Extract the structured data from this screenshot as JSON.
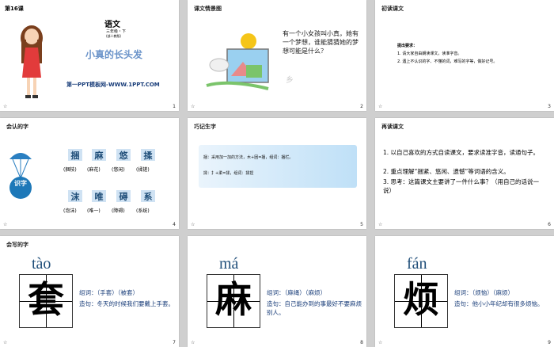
{
  "slides": [
    {
      "num": "1",
      "lesson": "第16课",
      "subject": "语文",
      "grade": "三年级・下",
      "edition": "(部人教版)",
      "title": "小真的长头发",
      "site": "第一PPT模板网-WWW.1PPT.COM"
    },
    {
      "num": "2",
      "header": "课文情景图",
      "text": "有一个小女孩叫小真，她有一个梦想，谁能猜猜她的梦想可能是什么？"
    },
    {
      "num": "3",
      "header": "初读课文",
      "req_title": "提出要求：",
      "req_items": [
        "1. 请大家自由朗读课文，读准字音。",
        "2. 遇上不认识的字、不懂的词，难写的字等，做好记号。"
      ]
    },
    {
      "num": "4",
      "header": "会认的字",
      "badge": "识字",
      "row1": [
        {
          "char": "捆",
          "word": "(捆枝)"
        },
        {
          "char": "麻",
          "word": "(麻花)"
        },
        {
          "char": "悠",
          "word": "(悠闲)"
        },
        {
          "char": "揉",
          "word": "(揉搓)"
        }
      ],
      "row2": [
        {
          "char": "沫",
          "word": "(泡沫)"
        },
        {
          "char": "唯",
          "word": "(唯一)"
        },
        {
          "char": "碍",
          "word": "(障碍)"
        },
        {
          "char": "系",
          "word": "(系统)"
        }
      ]
    },
    {
      "num": "5",
      "header": "巧记生字",
      "line1": "捆：采用加一加的方法，木+困=捆，组词：捆栏。",
      "line2": "揉：扌+柔=揉，组词：揉捏"
    },
    {
      "num": "6",
      "header": "再读课文",
      "items": [
        "1. 以自己喜欢的方式自读课文，要求读准字音，读通句子。",
        "2. 重点理解“捆紧、悠闲、遗憾”等词语的含义。",
        "3. 思考：这篇课文主要讲了一件什么事？（用自己的话说一说）"
      ]
    },
    {
      "num": "7",
      "header": "会写的字",
      "pinyin": "tào",
      "char": "套",
      "words": "组词：（手套）（被套）",
      "sentence": "造句：冬天的时候我们要戴上手套。"
    },
    {
      "num": "8",
      "pinyin": "má",
      "char": "麻",
      "words": "组词：（麻绳）（麻烦）",
      "sentence": "造句：自己能办到的事最好不要麻烦别人。"
    },
    {
      "num": "9",
      "pinyin": "fán",
      "char": "烦",
      "words": "组词：（烦恼）（麻烦）",
      "sentence": "造句：他小小年纪却有很多烦恼。"
    }
  ],
  "colors": {
    "accent": "#1d78b8",
    "title_blue": "#6a93c9",
    "char_box": "#cfe2f3"
  }
}
